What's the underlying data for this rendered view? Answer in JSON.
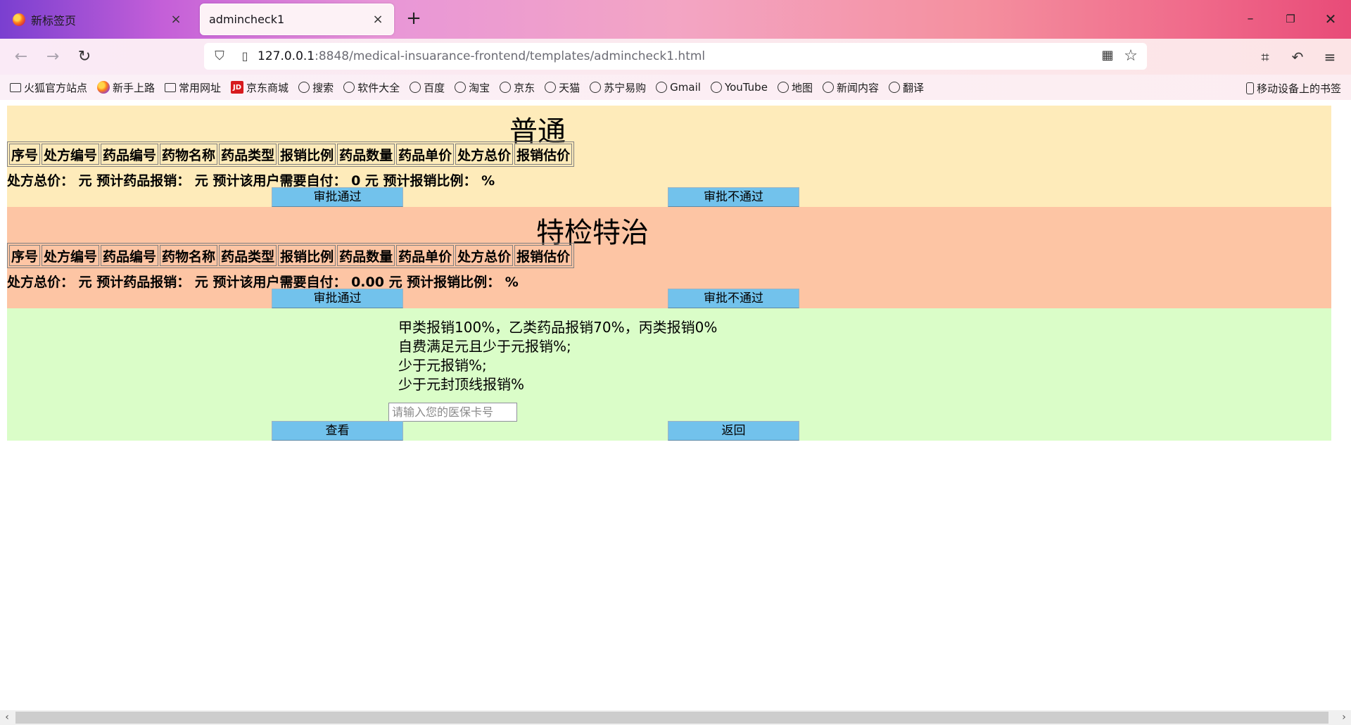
{
  "browser": {
    "tabs": [
      {
        "label": "新标签页",
        "active": false
      },
      {
        "label": "admincheck1",
        "active": true
      }
    ],
    "url_host": "127.0.0.1",
    "url_rest": ":8848/medical-insuarance-frontend/templates/admincheck1.html",
    "bookmarks": [
      {
        "label": "火狐官方站点",
        "icon": "folder-icon"
      },
      {
        "label": "新手上路",
        "icon": "firefox-icon"
      },
      {
        "label": "常用网址",
        "icon": "folder-icon"
      },
      {
        "label": "京东商城",
        "icon": "jd-icon"
      },
      {
        "label": "搜索",
        "icon": "globe-icon"
      },
      {
        "label": "软件大全",
        "icon": "globe-icon"
      },
      {
        "label": "百度",
        "icon": "globe-icon"
      },
      {
        "label": "淘宝",
        "icon": "globe-icon"
      },
      {
        "label": "京东",
        "icon": "globe-icon"
      },
      {
        "label": "天猫",
        "icon": "globe-icon"
      },
      {
        "label": "苏宁易购",
        "icon": "globe-icon"
      },
      {
        "label": "Gmail",
        "icon": "globe-icon"
      },
      {
        "label": "YouTube",
        "icon": "globe-icon"
      },
      {
        "label": "地图",
        "icon": "globe-icon"
      },
      {
        "label": "新闻内容",
        "icon": "globe-icon"
      },
      {
        "label": "翻译",
        "icon": "globe-icon"
      }
    ],
    "mobile_bookmarks": "移动设备上的书签"
  },
  "table_headers": [
    "序号",
    "处方编号",
    "药品编号",
    "药物名称",
    "药品类型",
    "报销比例",
    "药品数量",
    "药品单价",
    "处方总价",
    "报销估价"
  ],
  "sections": [
    {
      "title": "普通",
      "summary": "处方总价：  元 预计药品报销：  元 预计该用户需要自付：  0 元 预计报销比例：  %",
      "approve_label": "审批通过",
      "reject_label": "审批不通过"
    },
    {
      "title": "特检特治",
      "summary": "处方总价：  元 预计药品报销：  元 预计该用户需要自付：  0.00 元 预计报销比例：  %",
      "approve_label": "审批通过",
      "reject_label": "审批不通过"
    }
  ],
  "rules": {
    "lines": [
      "甲类报销100%，乙类药品报销70%，丙类报销0%",
      "自费满足元且少于元报销%;",
      "少于元报销%;",
      "少于元封顶线报销%"
    ],
    "card_placeholder": "请输入您的医保卡号",
    "view_label": "查看",
    "back_label": "返回"
  },
  "colors": {
    "section_normal_bg": "#feebba",
    "section_special_bg": "#fdc5a4",
    "section_rules_bg": "#dafdc8",
    "button_bg": "#72c2ec"
  }
}
